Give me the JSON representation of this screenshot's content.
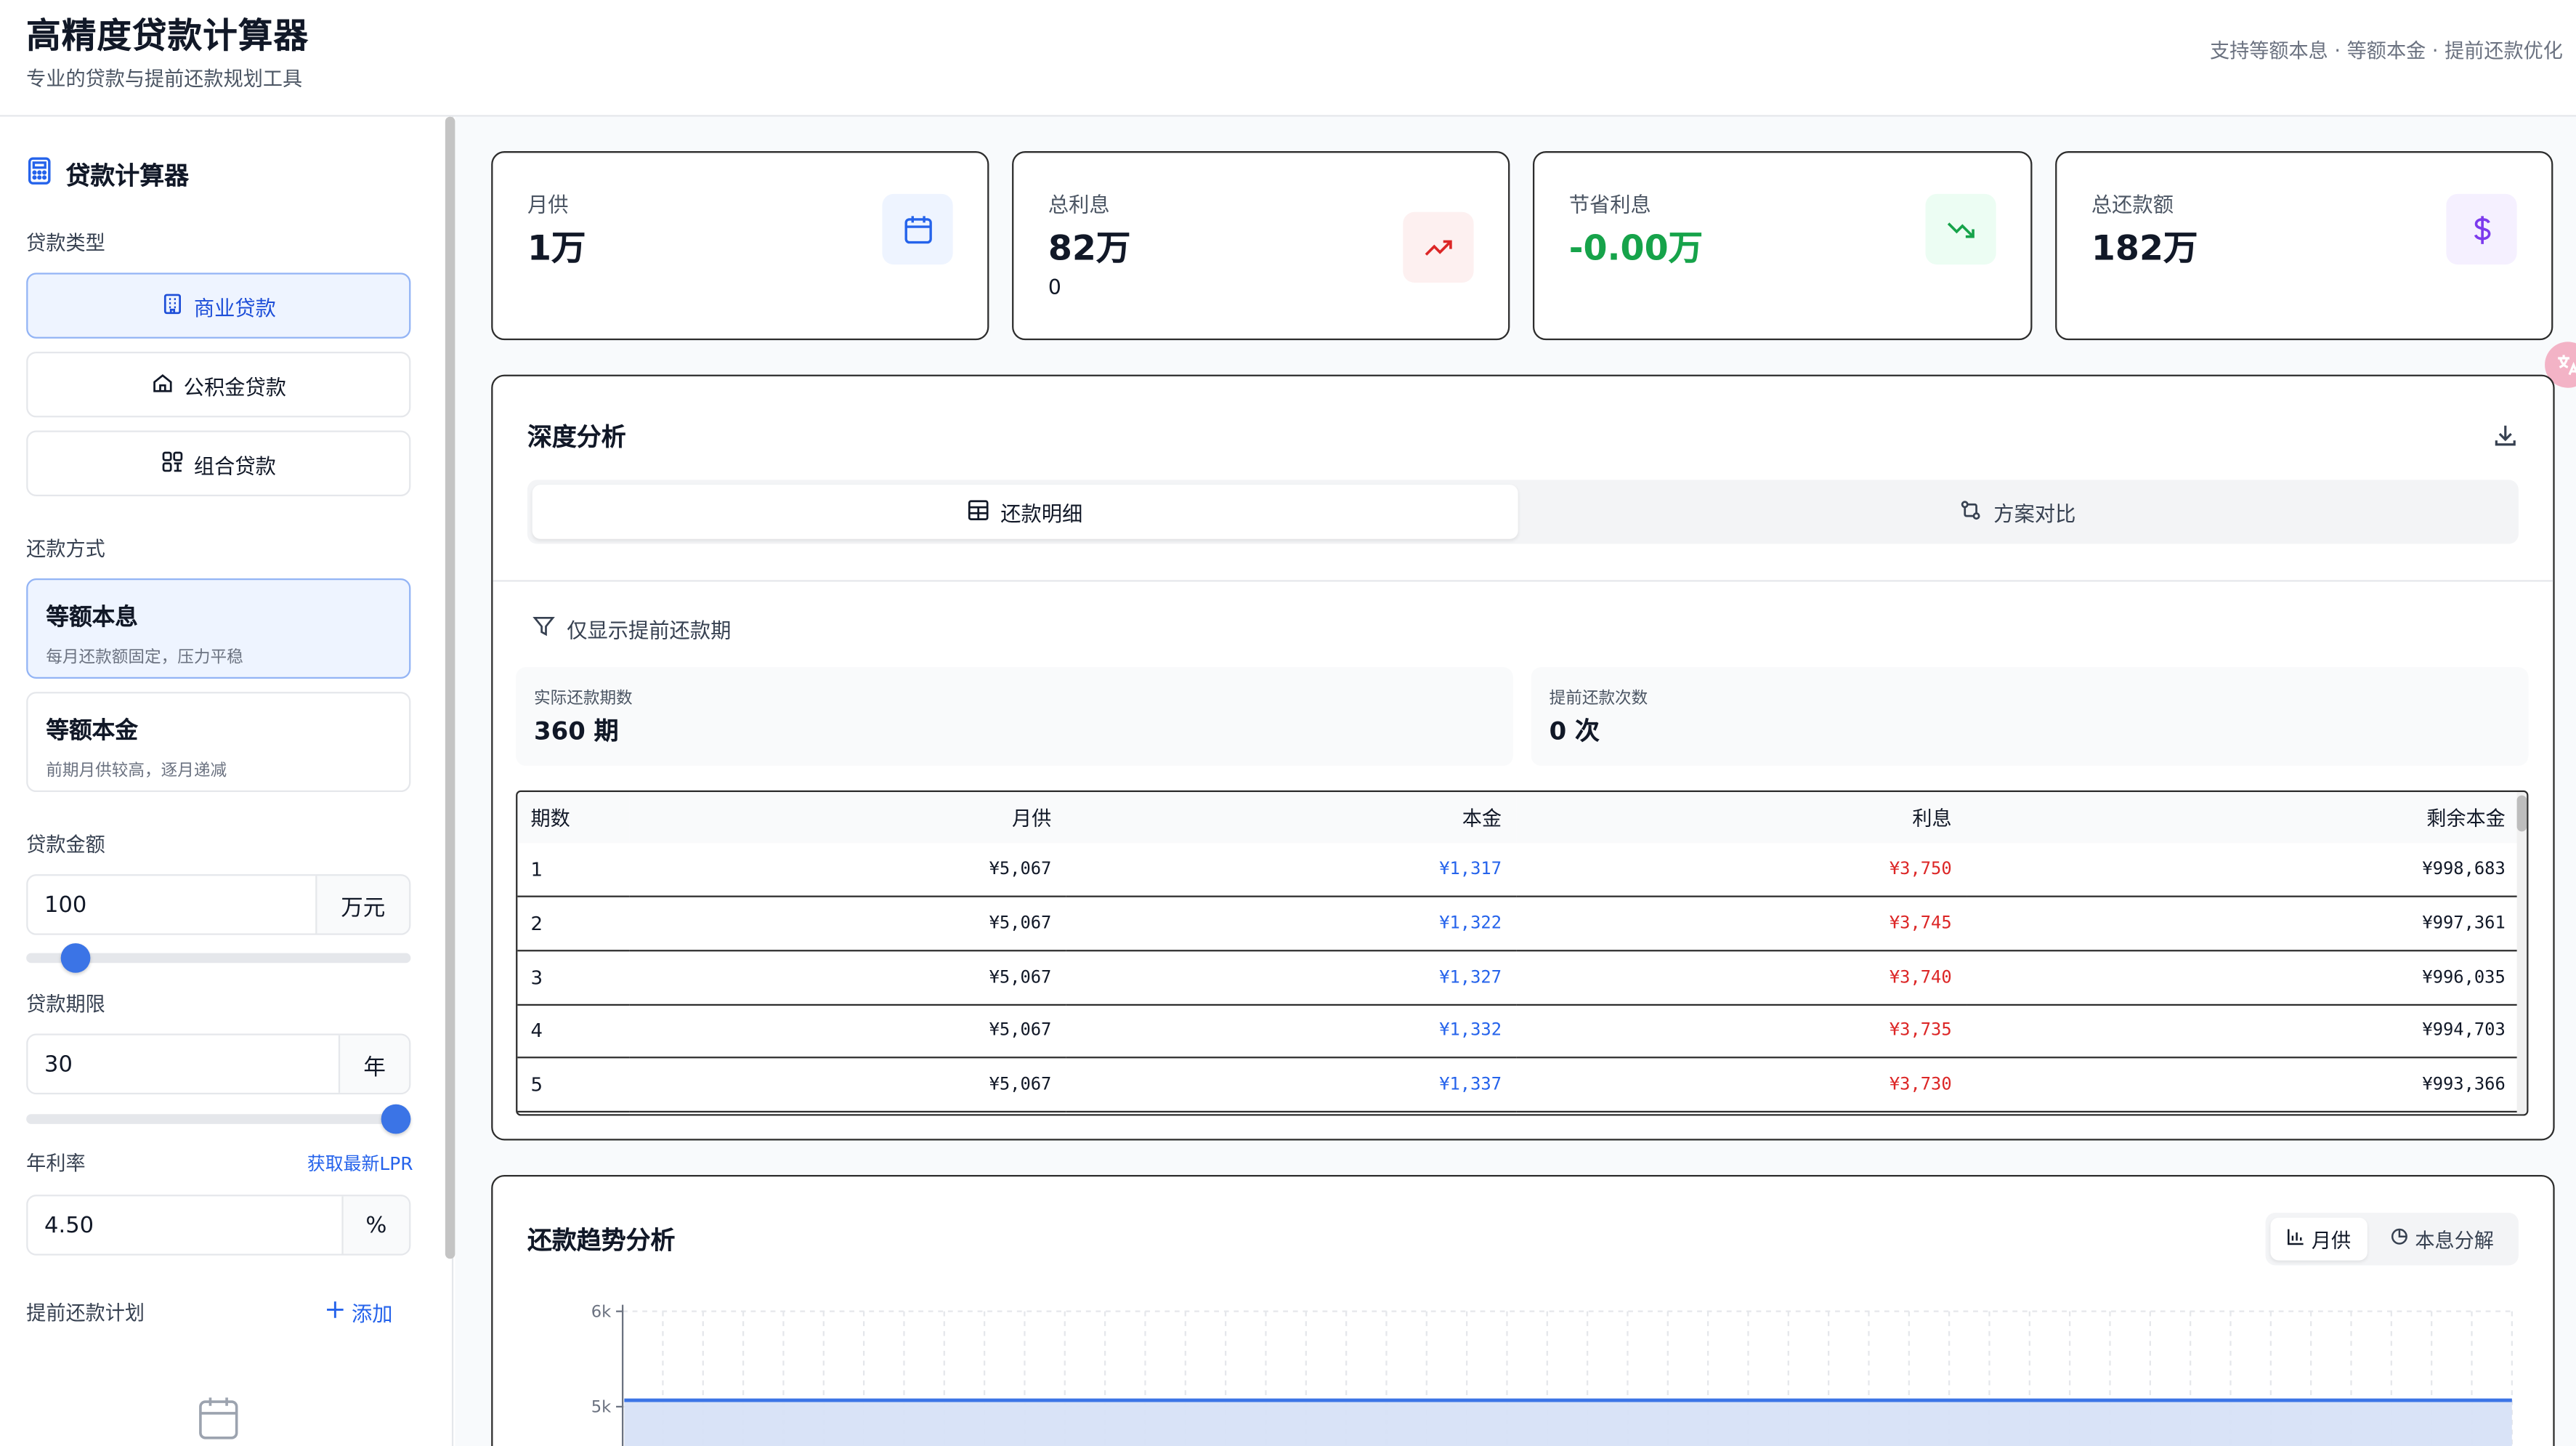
{
  "header": {
    "title": "高精度贷款计算器",
    "subtitle": "专业的贷款与提前还款规划工具",
    "features": "支持等额本息 · 等额本金 · 提前还款优化"
  },
  "sidebar": {
    "title": "贷款计算器",
    "loan_type_label": "贷款类型",
    "loan_types": [
      {
        "label": "商业贷款",
        "icon": "building-icon",
        "selected": true
      },
      {
        "label": "公积金贷款",
        "icon": "home-icon",
        "selected": false
      },
      {
        "label": "组合贷款",
        "icon": "combo-icon",
        "selected": false
      }
    ],
    "repay_method_label": "还款方式",
    "repay_methods": [
      {
        "title": "等额本息",
        "desc": "每月还款额固定，压力平稳",
        "selected": true
      },
      {
        "title": "等额本金",
        "desc": "前期月供较高，逐月递减",
        "selected": false
      }
    ],
    "amount": {
      "label": "贷款金额",
      "value": "100",
      "unit": "万元",
      "slider_fraction": 0.13
    },
    "term": {
      "label": "贷款期限",
      "value": "30",
      "unit": "年",
      "slider_fraction": 1.0
    },
    "rate": {
      "label": "年利率",
      "link": "获取最新LPR",
      "value": "4.50",
      "unit": "%"
    },
    "prepay": {
      "label": "提前还款计划",
      "add_label": "添加"
    }
  },
  "stats": [
    {
      "label": "月供",
      "value": "1万",
      "sub": "",
      "icon": "calendar-icon",
      "value_color": "#111827",
      "icon_bg": "#eef4ff",
      "icon_color": "#2563eb"
    },
    {
      "label": "总利息",
      "value": "82万",
      "sub": "0",
      "icon": "trending-up-icon",
      "value_color": "#111827",
      "icon_bg": "#fdf0f0",
      "icon_color": "#dc2626"
    },
    {
      "label": "节省利息",
      "value": "-0.00万",
      "sub": "",
      "icon": "trending-down-icon",
      "value_color": "#16a34a",
      "icon_bg": "#ecfdf3",
      "icon_color": "#16a34a"
    },
    {
      "label": "总还款额",
      "value": "182万",
      "sub": "",
      "icon": "dollar-icon",
      "value_color": "#111827",
      "icon_bg": "#f5f0ff",
      "icon_color": "#7c3aed"
    }
  ],
  "analysis": {
    "title": "深度分析",
    "tabs": [
      {
        "label": "还款明细",
        "icon": "table-icon",
        "active": true
      },
      {
        "label": "方案对比",
        "icon": "compare-icon",
        "active": false
      }
    ],
    "filter_label": "仅显示提前还款期",
    "info": [
      {
        "label": "实际还款期数",
        "value": "360 期"
      },
      {
        "label": "提前还款次数",
        "value": "0 次"
      }
    ],
    "table": {
      "headers": [
        "期数",
        "月供",
        "本金",
        "利息",
        "剩余本金"
      ],
      "rows": [
        [
          "1",
          "¥5,067",
          "¥1,317",
          "¥3,750",
          "¥998,683"
        ],
        [
          "2",
          "¥5,067",
          "¥1,322",
          "¥3,745",
          "¥997,361"
        ],
        [
          "3",
          "¥5,067",
          "¥1,327",
          "¥3,740",
          "¥996,035"
        ],
        [
          "4",
          "¥5,067",
          "¥1,332",
          "¥3,735",
          "¥994,703"
        ],
        [
          "5",
          "¥5,067",
          "¥1,337",
          "¥3,730",
          "¥993,366"
        ]
      ]
    }
  },
  "trend": {
    "title": "还款趋势分析",
    "toggle": [
      {
        "label": "月供",
        "icon": "bar-chart-icon",
        "active": true
      },
      {
        "label": "本息分解",
        "icon": "pie-chart-icon",
        "active": false
      }
    ],
    "chart_data": {
      "type": "area",
      "y_ticks": [
        "6k",
        "5k"
      ],
      "ylim": [
        0,
        6000
      ],
      "x_count": 360,
      "series": [
        {
          "values": [
            5067
          ]
        }
      ],
      "line_color": "#3b74e6",
      "fill_color": "#d7e2f7"
    }
  }
}
